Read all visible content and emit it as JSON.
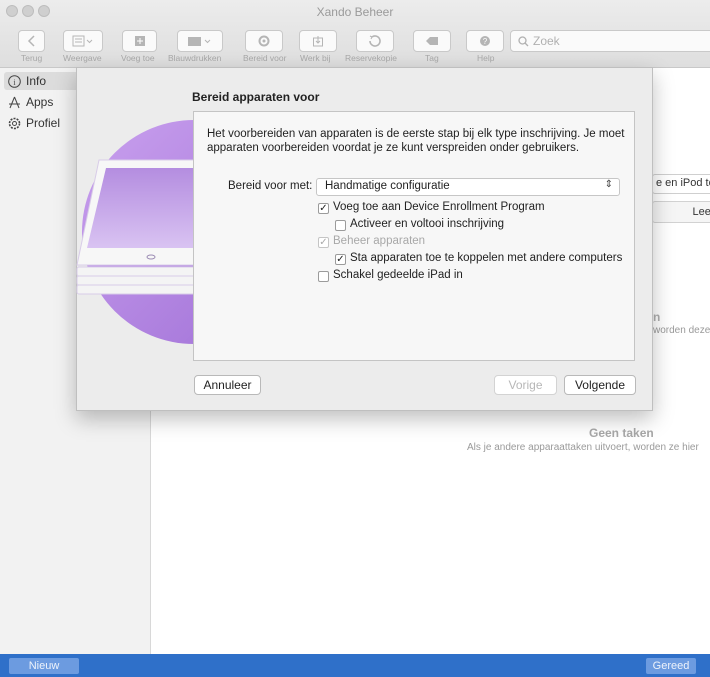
{
  "window": {
    "title": "Xando Beheer"
  },
  "toolbar": {
    "back": "Terug",
    "view": "Weergave",
    "add": "Voeg toe",
    "blueprints": "Blauwdrukken",
    "prepare": "Bereid voor",
    "update": "Werk bij",
    "backup": "Reservekopie",
    "tag": "Tag",
    "help": "Help",
    "search_placeholder": "Zoek"
  },
  "sidebar": {
    "items": [
      {
        "label": "Info",
        "icon": "info-icon",
        "selected": true
      },
      {
        "label": "Apps",
        "icon": "apps-icon",
        "selected": false
      },
      {
        "label": "Profiel",
        "icon": "profile-icon",
        "selected": false
      }
    ]
  },
  "background": {
    "device_filter": "e en iPod to",
    "empty_button": "Leeg",
    "n_heading": "n",
    "n_sub": "worden deze",
    "no_tasks_title": "Geen taken",
    "no_tasks_sub": "Als je andere apparaattaken uitvoert, worden ze hier"
  },
  "dialog": {
    "title": "Bereid apparaten voor",
    "intro": "Het voorbereiden van apparaten is de eerste stap bij elk type inschrijving. Je moet apparaten voorbereiden voordat je ze kunt verspreiden onder gebruikers.",
    "prepare_with_label": "Bereid voor met:",
    "prepare_with_value": "Handmatige configuratie",
    "options": [
      {
        "label": "Voeg toe aan Device Enrollment Program",
        "checked": true,
        "disabled": false
      },
      {
        "label": "Activeer en voltooi inschrijving",
        "checked": false,
        "disabled": false
      },
      {
        "label": "Beheer apparaten",
        "checked": true,
        "disabled": true
      },
      {
        "label": "Sta apparaten toe te koppelen met andere computers",
        "checked": true,
        "disabled": false
      },
      {
        "label": "Schakel gedeelde iPad in",
        "checked": false,
        "disabled": false
      }
    ],
    "cancel": "Annuleer",
    "previous": "Vorige",
    "next": "Volgende"
  },
  "bottombar": {
    "new": "Nieuw",
    "done": "Gereed"
  },
  "colors": {
    "accent": "#2f70c9",
    "hero_purple": "#b98ae0"
  }
}
